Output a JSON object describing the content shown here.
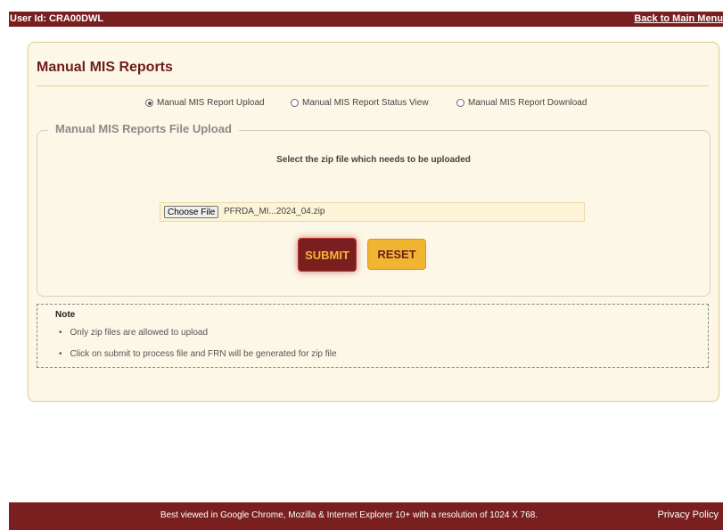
{
  "header": {
    "user_id_label": "User Id: CRA00DWL",
    "back_link": "Back to Main Menu"
  },
  "panel": {
    "title": "Manual MIS Reports",
    "radios": [
      {
        "label": "Manual MIS Report Upload",
        "selected": true
      },
      {
        "label": "Manual MIS Report Status View",
        "selected": false
      },
      {
        "label": "Manual MIS Report Download",
        "selected": false
      }
    ]
  },
  "upload": {
    "legend": "Manual MIS Reports File Upload",
    "instruction": "Select the zip file which needs to be uploaded",
    "choose_file_label": "Choose File",
    "file_name": "PFRDA_MI...2024_04.zip",
    "submit_label": "SUBMIT",
    "reset_label": "RESET"
  },
  "note": {
    "title": "Note",
    "items": [
      "Only zip files are allowed to upload",
      "Click on submit to process file and FRN will be generated for zip file"
    ]
  },
  "footer": {
    "text": "Best viewed in Google Chrome, Mozilla & Internet Explorer 10+ with a resolution of 1024 X 768.",
    "privacy": "Privacy Policy"
  },
  "colors": {
    "maroon": "#7a1f1f",
    "gold": "#f2b532",
    "panel_bg": "#fdf7e7"
  }
}
